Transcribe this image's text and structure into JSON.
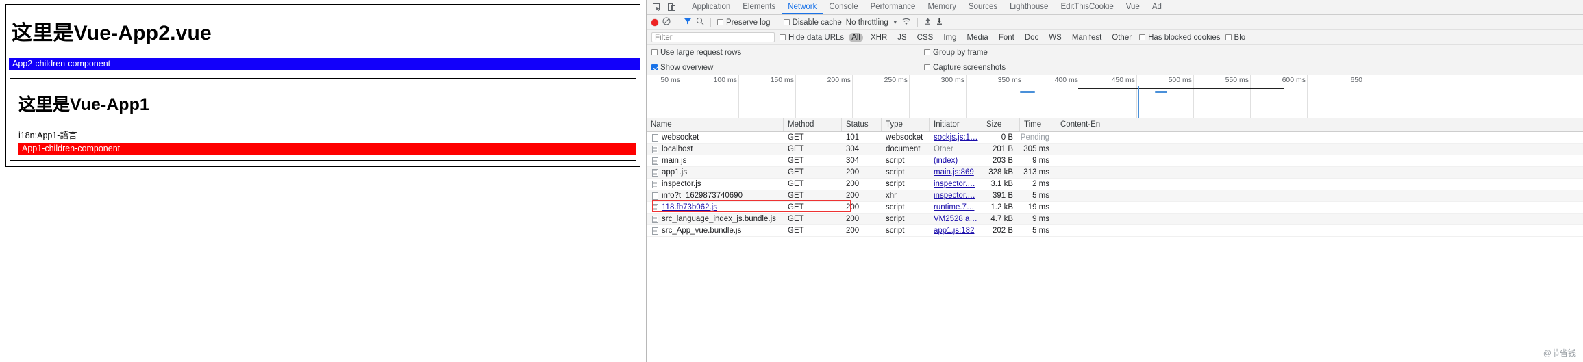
{
  "page": {
    "app2_title": "这里是Vue-App2.vue",
    "app2_child_bar": "App2-children-component",
    "app1_title": "这里是Vue-App1",
    "i18n_line": "i18n:App1-語言",
    "app1_child_bar": "App1-children-component",
    "colors": {
      "blue_bar": "#1200fa",
      "red_bar": "#fe0000"
    }
  },
  "devtools": {
    "tabs": [
      {
        "label": "Application",
        "active": false
      },
      {
        "label": "Elements",
        "active": false
      },
      {
        "label": "Network",
        "active": true
      },
      {
        "label": "Console",
        "active": false
      },
      {
        "label": "Performance",
        "active": false
      },
      {
        "label": "Memory",
        "active": false
      },
      {
        "label": "Sources",
        "active": false
      },
      {
        "label": "Lighthouse",
        "active": false
      },
      {
        "label": "EditThisCookie",
        "active": false
      },
      {
        "label": "Vue",
        "active": false
      },
      {
        "label": "Ad",
        "active": false
      }
    ],
    "icons": {
      "inspect": "inspect-element-icon",
      "device": "toggle-device-toolbar-icon",
      "record": "record-button-icon",
      "clear": "clear-icon",
      "filter": "filter-icon",
      "search": "search-icon",
      "throttle": "network-conditions-icon",
      "import": "import-har-icon",
      "export": "export-har-icon"
    },
    "toolbar": {
      "preserve_log": "Preserve log",
      "preserve_log_checked": false,
      "disable_cache": "Disable cache",
      "disable_cache_checked": false,
      "throttling": "No throttling"
    },
    "filterbar": {
      "filter_placeholder": "Filter",
      "filter_value": "",
      "hide_data_urls": "Hide data URLs",
      "hide_data_urls_checked": false,
      "types": [
        {
          "label": "All",
          "selected": true
        },
        {
          "label": "XHR",
          "selected": false
        },
        {
          "label": "JS",
          "selected": false
        },
        {
          "label": "CSS",
          "selected": false
        },
        {
          "label": "Img",
          "selected": false
        },
        {
          "label": "Media",
          "selected": false
        },
        {
          "label": "Font",
          "selected": false
        },
        {
          "label": "Doc",
          "selected": false
        },
        {
          "label": "WS",
          "selected": false
        },
        {
          "label": "Manifest",
          "selected": false
        },
        {
          "label": "Other",
          "selected": false
        }
      ],
      "has_blocked_cookies": "Has blocked cookies",
      "has_blocked_cookies_checked": false,
      "blocked_requests": "Blo"
    },
    "options": {
      "use_large_request_rows": "Use large request rows",
      "use_large_request_rows_checked": false,
      "group_by_frame": "Group by frame",
      "group_by_frame_checked": false,
      "show_overview": "Show overview",
      "show_overview_checked": true,
      "capture_screenshots": "Capture screenshots",
      "capture_screenshots_checked": false
    },
    "overview": {
      "ticks": [
        "50 ms",
        "100 ms",
        "150 ms",
        "200 ms",
        "250 ms",
        "300 ms",
        "350 ms",
        "400 ms",
        "450 ms",
        "500 ms",
        "550 ms",
        "600 ms",
        "650"
      ]
    },
    "table": {
      "columns": [
        "Name",
        "Method",
        "Status",
        "Type",
        "Initiator",
        "Size",
        "Time",
        "Content-En"
      ],
      "rows": [
        {
          "name": "websocket",
          "method": "GET",
          "status": "101",
          "type": "websocket",
          "initiator": "sockjs.js:1…",
          "size": "0 B",
          "time": "Pending",
          "time_pending": true,
          "icon": "plain-file-icon"
        },
        {
          "name": "localhost",
          "method": "GET",
          "status": "304",
          "type": "document",
          "initiator": "Other",
          "initiator_plain": true,
          "size": "201 B",
          "time": "305 ms",
          "icon": "document-file-icon"
        },
        {
          "name": "main.js",
          "method": "GET",
          "status": "304",
          "type": "script",
          "initiator": "(index)",
          "size": "203 B",
          "time": "9 ms",
          "icon": "document-file-icon"
        },
        {
          "name": "app1.js",
          "method": "GET",
          "status": "200",
          "type": "script",
          "initiator": "main.js:869",
          "size": "328 kB",
          "time": "313 ms",
          "icon": "document-file-icon"
        },
        {
          "name": "inspector.js",
          "method": "GET",
          "status": "200",
          "type": "script",
          "initiator": "inspector.…",
          "size": "3.1 kB",
          "time": "2 ms",
          "icon": "document-file-icon"
        },
        {
          "name": "info?t=1629873740690",
          "method": "GET",
          "status": "200",
          "type": "xhr",
          "initiator": "inspector.…",
          "size": "391 B",
          "time": "5 ms",
          "icon": "plain-file-icon"
        },
        {
          "name": "118.fb73b062.js",
          "method": "GET",
          "status": "200",
          "type": "script",
          "initiator": "runtime.7…",
          "size": "1.2 kB",
          "time": "19 ms",
          "icon": "document-file-icon",
          "highlighted": true
        },
        {
          "name": "src_language_index_js.bundle.js",
          "method": "GET",
          "status": "200",
          "type": "script",
          "initiator": "VM2528 a…",
          "size": "4.7 kB",
          "time": "9 ms",
          "icon": "document-file-icon"
        },
        {
          "name": "src_App_vue.bundle.js",
          "method": "GET",
          "status": "200",
          "type": "script",
          "initiator": "app1.js:182",
          "size": "202 B",
          "time": "5 ms",
          "icon": "document-file-icon"
        }
      ]
    },
    "watermark": "@节省钱"
  }
}
